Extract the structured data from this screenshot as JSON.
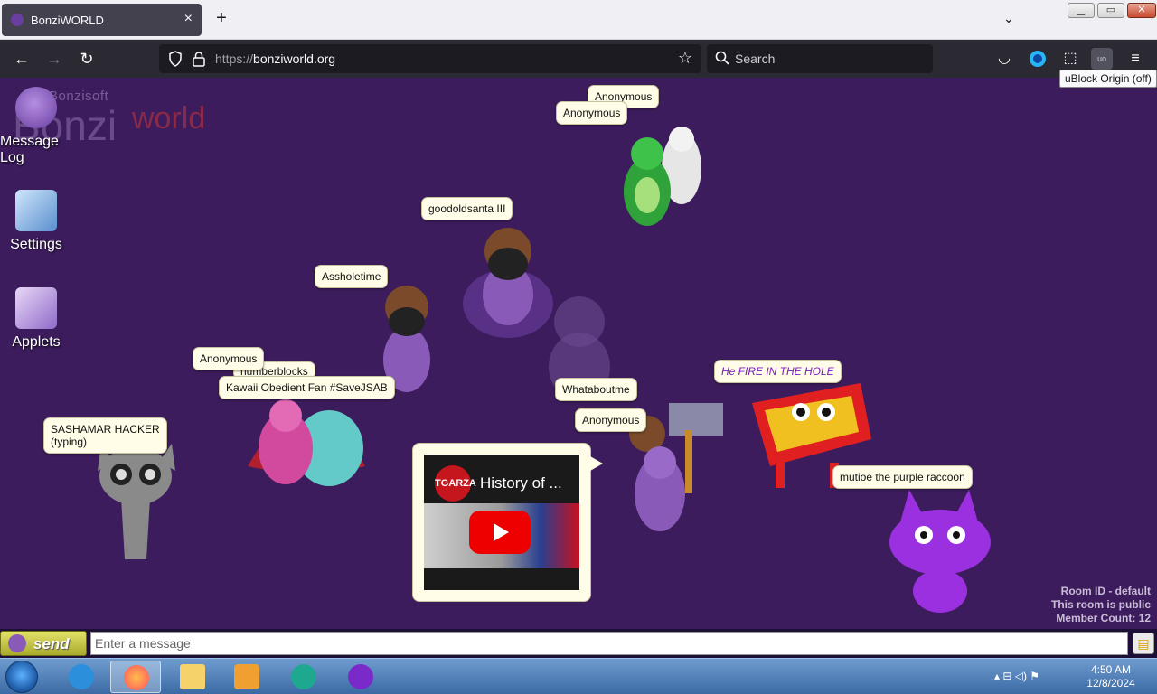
{
  "browser": {
    "tab_title": "BonziWORLD",
    "tab_close": "×",
    "new_tab": "+",
    "tab_list": "⌄",
    "window_controls": {
      "minimize": "▁",
      "maximize": "▭",
      "close": "✕"
    },
    "nav": {
      "back": "←",
      "forward": "→",
      "reload": "↻"
    },
    "url_scheme": "https://",
    "url_host": "bonziworld.org",
    "bookmark_star": "☆",
    "search_placeholder": "Search",
    "toolbar": {
      "pocket": "◡",
      "account": "●",
      "extensions": "⬚",
      "ublock": "uo",
      "menu": "≡"
    },
    "tooltip": "uBlock Origin (off)"
  },
  "page": {
    "logo": {
      "small": "Bonzisoft",
      "bonzi": "Bonzi",
      "world": "world"
    },
    "desktop_icons": [
      {
        "label": "Message Log"
      },
      {
        "label": "Settings"
      },
      {
        "label": "Applets"
      }
    ],
    "bubbles": {
      "anon1": "Anonymous",
      "anon2": "Anonymous",
      "goodoldsanta": "goodoldsanta III",
      "assholetime": "Assholetime",
      "anon3": "Anonymous",
      "numberblocks": "numberblocks",
      "kawaii": "Kawaii Obedient Fan #SaveJSAB",
      "sashamar_name": "SASHAMAR HACKER",
      "sashamar_status": "(typing)",
      "whataboutme": "Whataboutme",
      "anon4": "Anonymous",
      "fire": "He FIRE IN THE HOLE",
      "mutioe": "mutioe the purple raccoon"
    },
    "video": {
      "channel": "TGARZA",
      "title": "History of ..."
    },
    "room": {
      "id": "Room ID - default",
      "visibility": "This room is public",
      "members": "Member Count: 12"
    },
    "chat": {
      "send_label": "send",
      "input_placeholder": "Enter a message",
      "attach_icon": "▤"
    }
  },
  "taskbar": {
    "tray_icons": "▴  ⊟  ◁)  ⚑",
    "time": "4:50 AM",
    "date": "12/8/2024"
  },
  "colors": {
    "page_bg": "#3c1c5c",
    "bubble_bg": "#fffde8",
    "accent_green": "#1db84f",
    "accent_purple": "#7a1ac0"
  }
}
